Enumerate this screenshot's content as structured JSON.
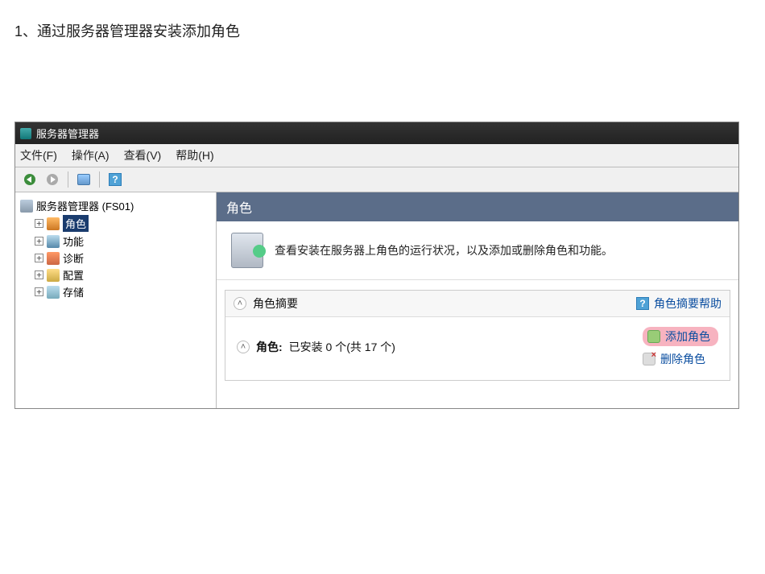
{
  "caption": "1、通过服务器管理器安装添加角色",
  "window": {
    "title": "服务器管理器",
    "menubar": {
      "file": "文件(F)",
      "action": "操作(A)",
      "view": "查看(V)",
      "help": "帮助(H)"
    },
    "toolbar": {
      "back": "back-icon",
      "forward": "forward-icon",
      "windows": "windows-icon",
      "help": "?"
    },
    "tree": {
      "root": "服务器管理器 (FS01)",
      "nodes": {
        "roles": "角色",
        "features": "功能",
        "diagnostics": "诊断",
        "configuration": "配置",
        "storage": "存储"
      },
      "expander": "+"
    },
    "panel": {
      "header": "角色",
      "intro": "查看安装在服务器上角色的运行状况，以及添加或删除角色和功能。",
      "summary": {
        "title": "角色摘要",
        "helplink": "角色摘要帮助",
        "installed_label": "角色:",
        "installed_text": "已安装 0 个(共 17 个)",
        "add_role": "添加角色",
        "remove_role": "删除角色"
      }
    }
  }
}
